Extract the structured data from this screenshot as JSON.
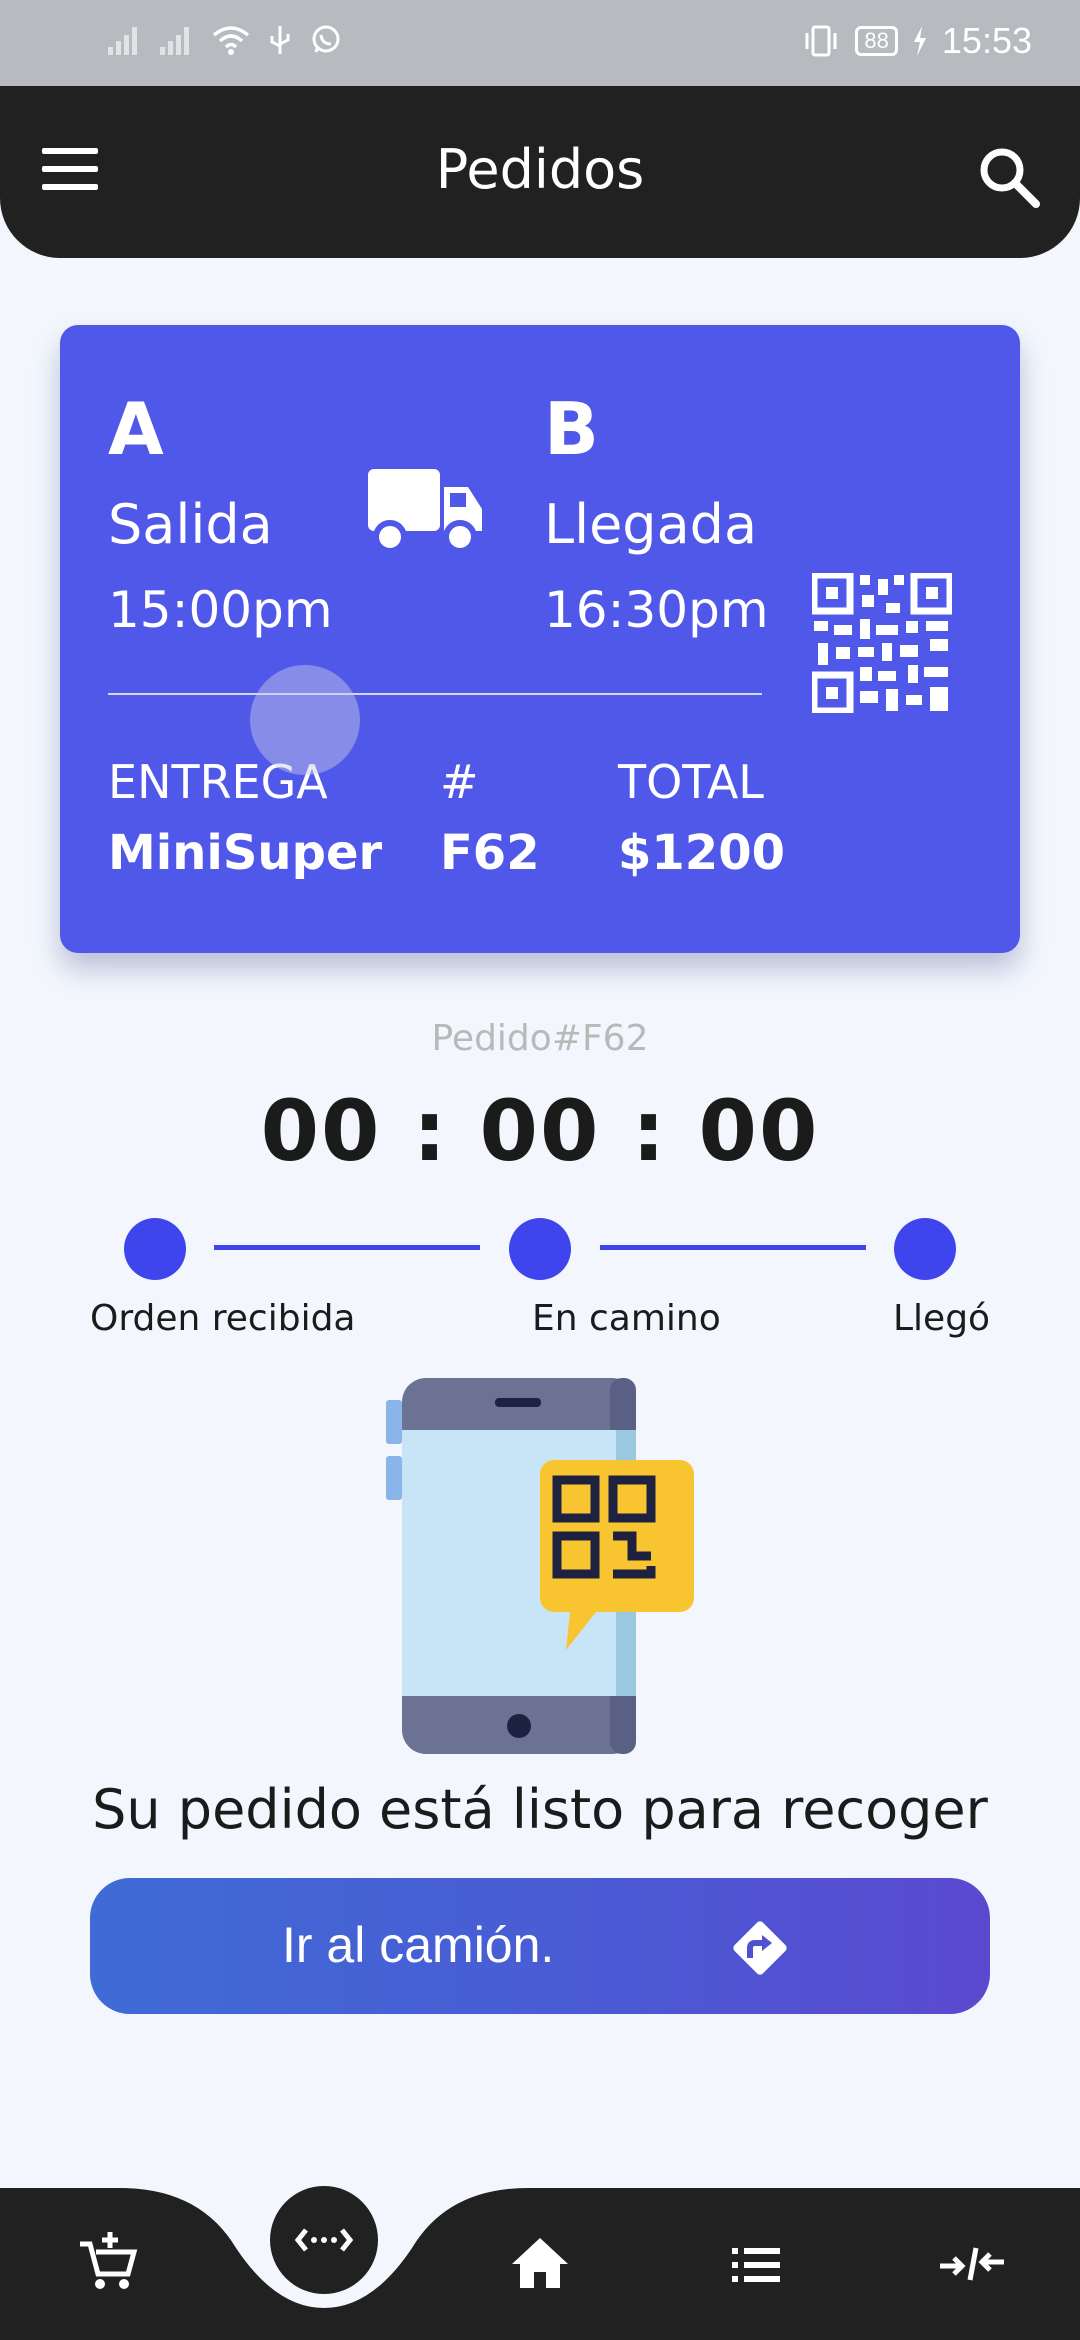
{
  "status_bar": {
    "time": "15:53",
    "battery": "88"
  },
  "app_bar": {
    "title": "Pedidos"
  },
  "ticket": {
    "origin_letter": "A",
    "origin_label": "Salida",
    "origin_time": "15:00pm",
    "dest_letter": "B",
    "dest_label": "Llegada",
    "dest_time": "16:30pm",
    "delivery_caption": "ENTREGA",
    "delivery_value": "MiniSuper",
    "number_caption": "#",
    "number_value": "F62",
    "total_caption": "TOTAL",
    "total_value": "$1200"
  },
  "order": {
    "label": "Pedido#F62",
    "timer": "00 : 00 : 00"
  },
  "steps": [
    {
      "label": "Orden recibida"
    },
    {
      "label": "En camino"
    },
    {
      "label": "Llegó"
    }
  ],
  "message": "Su pedido está listo para recoger",
  "action_button": {
    "label": "Ir al camión."
  },
  "colors": {
    "accent": "#5058ea",
    "step": "#3f45ec",
    "appbar": "#212121",
    "background": "#f3f7fd"
  },
  "icons": {
    "menu": "menu-icon",
    "search": "search-icon",
    "truck": "truck-icon",
    "qr": "qr-code-icon",
    "directions": "directions-icon",
    "nav": [
      "add-cart-icon",
      "code-arrows-icon",
      "home-icon",
      "list-icon",
      "compress-icon"
    ]
  }
}
